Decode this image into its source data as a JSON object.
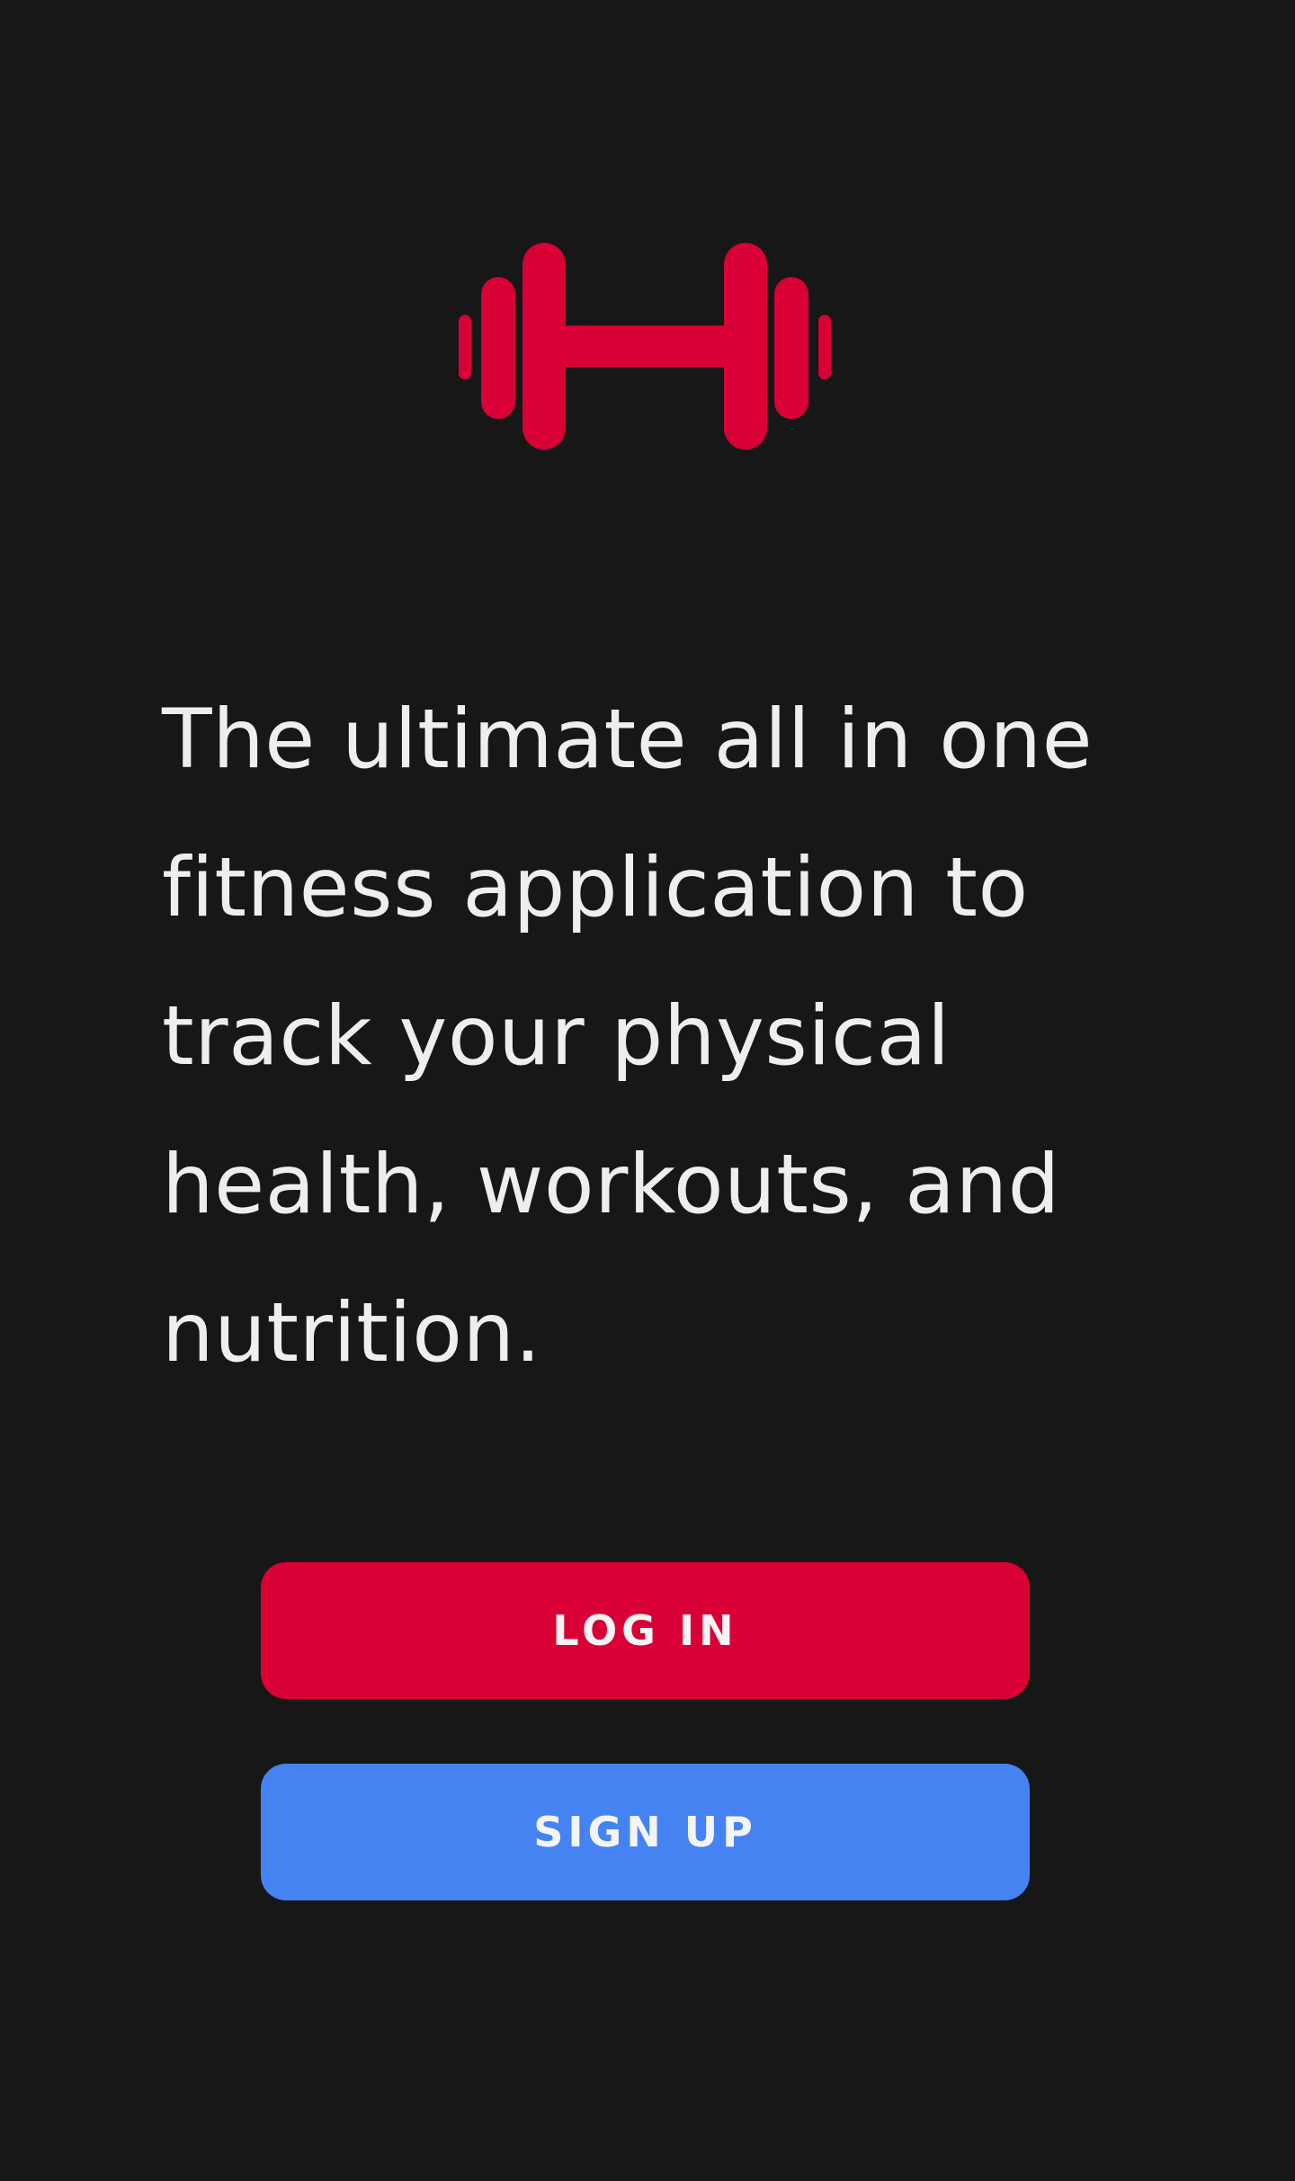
{
  "colors": {
    "background": "#171718",
    "brand_red": "#d80035",
    "signup_blue": "#4683f2",
    "text": "#eeeeee"
  },
  "logo": {
    "icon": "dumbbell-icon"
  },
  "tagline": {
    "text": "The ultimate all in one fitness application to track your physical health, workouts, and nutrition."
  },
  "buttons": {
    "login_label": "LOG IN",
    "signup_label": "SIGN UP"
  }
}
